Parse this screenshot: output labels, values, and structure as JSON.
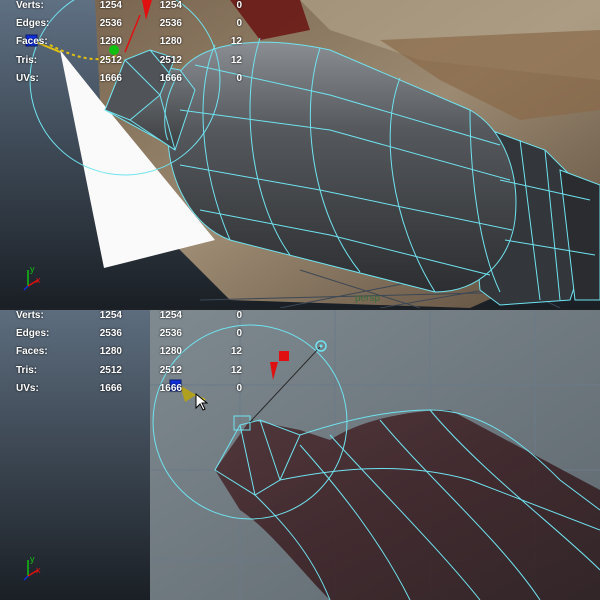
{
  "stats": {
    "rows": [
      {
        "label": "Verts:",
        "values": [
          "1254",
          "1254",
          "0"
        ]
      },
      {
        "label": "Edges:",
        "values": [
          "2536",
          "2536",
          "0"
        ]
      },
      {
        "label": "Faces:",
        "values": [
          "1280",
          "1280",
          "12"
        ]
      },
      {
        "label": "Tris:",
        "values": [
          "2512",
          "2512",
          "12"
        ]
      },
      {
        "label": "UVs:",
        "values": [
          "1666",
          "1666",
          "0"
        ]
      }
    ]
  },
  "viewport_label": "persp",
  "axis": {
    "y": "y",
    "x": "x",
    "z": "z"
  },
  "colors": {
    "wire": "#6fe3f0",
    "manip_x": "#e01010",
    "manip_y": "#10c010",
    "manip_z": "#1030e0",
    "manip_handle": "#e0c010",
    "vp_grad_top": "#5c6d80",
    "vp_grad_bottom": "#1b2026"
  }
}
